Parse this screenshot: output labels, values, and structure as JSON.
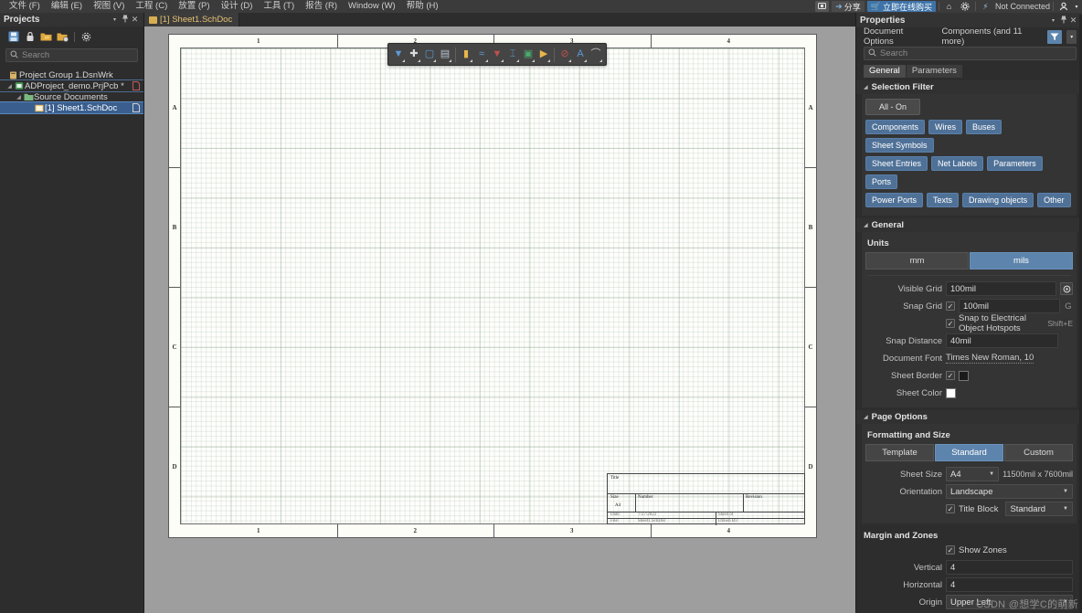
{
  "menubar": {
    "items": [
      {
        "label": "文件 (F)"
      },
      {
        "label": "编辑 (E)"
      },
      {
        "label": "视图 (V)"
      },
      {
        "label": "工程 (C)"
      },
      {
        "label": "放置 (P)"
      },
      {
        "label": "设计 (D)"
      },
      {
        "label": "工具 (T)"
      },
      {
        "label": "报告 (R)"
      },
      {
        "label": "Window (W)"
      },
      {
        "label": "帮助 (H)"
      }
    ],
    "right": {
      "notification_icon": "message-icon",
      "share_label": "分享",
      "share_icon": "share-arrow-icon",
      "buy_label": "立即在线购买",
      "buy_icon": "cart-icon",
      "home_icon": "home-icon",
      "settings_icon": "gear-icon",
      "connection_icon": "plug-icon",
      "connection_status": "Not Connected",
      "account_icon": "user-icon",
      "account_caret": "▾"
    }
  },
  "projects_panel": {
    "title": "Projects",
    "header_buttons": [
      "▾",
      "📌",
      "✕"
    ],
    "toolbar_icons": [
      "save-icon",
      "lock-icon",
      "open-project-icon",
      "add-folder-icon",
      "gear-icon"
    ],
    "search": {
      "placeholder": "Search",
      "value": "",
      "icon": "search-icon"
    },
    "tree": [
      {
        "label": "Project Group 1.DsnWrk",
        "icon": "workspace-icon",
        "level": 1,
        "arrow": "",
        "selected": false,
        "outlined": false,
        "right_icon": ""
      },
      {
        "label": "ADProject_demo.PrjPcb *",
        "icon": "project-icon",
        "level": 2,
        "arrow": "◢",
        "selected": false,
        "outlined": true,
        "right_icon": "doc-red-icon"
      },
      {
        "label": "Source Documents",
        "icon": "folder-icon",
        "level": 3,
        "arrow": "◢",
        "selected": false,
        "outlined": false,
        "right_icon": ""
      },
      {
        "label": "[1] Sheet1.SchDoc",
        "icon": "sheet-icon",
        "level": 4,
        "arrow": "",
        "selected": true,
        "outlined": false,
        "right_icon": "doc-icon"
      }
    ]
  },
  "document_tabs": [
    {
      "label": "[1] Sheet1.SchDoc",
      "icon": "schdoc-icon",
      "active": true
    }
  ],
  "float_toolbar": {
    "buttons": [
      {
        "name": "filter-icon",
        "glyph": "▼",
        "color": "#5d9bd5",
        "dropdown": true
      },
      {
        "name": "crosshair-place-icon",
        "glyph": "✚",
        "color": "#dcdcdc",
        "dropdown": true
      },
      {
        "name": "select-area-icon",
        "glyph": "▢",
        "color": "#5d9bd5",
        "dropdown": true
      },
      {
        "name": "align-icon",
        "glyph": "▤",
        "color": "#b8c4cf",
        "dropdown": true
      },
      {
        "name": "place-part-icon",
        "glyph": "▮",
        "color": "#e8b64a",
        "dropdown": true
      },
      {
        "name": "place-wire-icon",
        "glyph": "≈",
        "color": "#5d9bd5",
        "dropdown": true
      },
      {
        "name": "place-power-port-icon",
        "glyph": "▼",
        "color": "#c0504d",
        "dropdown": true
      },
      {
        "name": "place-net-label-icon",
        "glyph": "⌶",
        "color": "#5d9bd5",
        "dropdown": true
      },
      {
        "name": "place-sheet-symbol-icon",
        "glyph": "▣",
        "color": "#4aa96c",
        "dropdown": true
      },
      {
        "name": "place-port-icon",
        "glyph": "▶",
        "color": "#e8b64a",
        "dropdown": true
      },
      {
        "name": "no-erc-icon",
        "glyph": "⊘",
        "color": "#c0504d",
        "dropdown": true
      },
      {
        "name": "place-text-icon",
        "glyph": "A",
        "color": "#5d9bd5",
        "dropdown": true
      },
      {
        "name": "place-arc-icon",
        "glyph": "⌒",
        "color": "#c9c9c9",
        "dropdown": true
      }
    ]
  },
  "schematic": {
    "zones_top": [
      "1",
      "2",
      "3",
      "4"
    ],
    "zones_bottom": [
      "1",
      "2",
      "3",
      "4"
    ],
    "zones_left": [
      "A",
      "B",
      "C",
      "D"
    ],
    "zones_right": [
      "A",
      "B",
      "C",
      "D"
    ],
    "title_block": {
      "title_label": "Title",
      "title_value": "",
      "size_label": "Size",
      "size_value": "A4",
      "number_label": "Number",
      "number_value": "",
      "revision_label": "Revision",
      "revision_value": "",
      "date_label": "Date:",
      "date_value": "7/27/2022",
      "sheet_label": "Sheet   of",
      "file_label": "File:",
      "file_value": "Sheet1.SchDoc",
      "drawnby_label": "Drawn By:",
      "side_marker": "D"
    }
  },
  "properties_panel": {
    "title": "Properties",
    "header_buttons": [
      "▾",
      "📌",
      "✕"
    ],
    "object_type": "Document Options",
    "selection_summary": "Components (and 11 more)",
    "filter_icon": "funnel-icon",
    "filter_caret": "▾",
    "search": {
      "placeholder": "Search",
      "value": "",
      "icon": "search-icon"
    },
    "tabs": [
      {
        "label": "General",
        "active": true
      },
      {
        "label": "Parameters",
        "active": false
      }
    ],
    "selection_filter": {
      "section_title": "Selection Filter",
      "all_on_label": "All - On",
      "chips": [
        "Components",
        "Wires",
        "Buses",
        "Sheet Symbols",
        "Sheet Entries",
        "Net Labels",
        "Parameters",
        "Ports",
        "Power Ports",
        "Texts",
        "Drawing objects",
        "Other"
      ]
    },
    "general": {
      "section_title": "General",
      "units_label": "Units",
      "units_options": [
        {
          "label": "mm",
          "selected": false
        },
        {
          "label": "mils",
          "selected": true
        }
      ],
      "visible_grid_label": "Visible Grid",
      "visible_grid_value": "100mil",
      "visible_grid_btn_icon": "grid-settings-icon",
      "snap_grid_label": "Snap Grid",
      "snap_grid_checked": true,
      "snap_grid_value": "100mil",
      "snap_grid_shortcut": "G",
      "snap_hotspots_checked": true,
      "snap_hotspots_label": "Snap to Electrical Object Hotspots",
      "snap_hotspots_shortcut": "Shift+E",
      "snap_distance_label": "Snap Distance",
      "snap_distance_value": "40mil",
      "document_font_label": "Document Font",
      "document_font_value": "Times New Roman, 10",
      "sheet_border_label": "Sheet Border",
      "sheet_border_checked": true,
      "sheet_border_color": "#1a1a1a",
      "sheet_color_label": "Sheet Color",
      "sheet_color": "#ffffff"
    },
    "page_options": {
      "section_title": "Page Options",
      "formatting_title": "Formatting and Size",
      "format_options": [
        {
          "label": "Template",
          "selected": false
        },
        {
          "label": "Standard",
          "selected": true
        },
        {
          "label": "Custom",
          "selected": false
        }
      ],
      "sheet_size_label": "Sheet Size",
      "sheet_size_value": "A4",
      "sheet_dimensions": "11500mil x 7600mil",
      "orientation_label": "Orientation",
      "orientation_value": "Landscape",
      "title_block_label": "Title Block",
      "title_block_checked": true,
      "title_block_value": "Standard"
    },
    "margin_and_zones": {
      "section_title": "Margin and Zones",
      "show_zones_label": "Show Zones",
      "show_zones_checked": true,
      "vertical_label": "Vertical",
      "vertical_value": "4",
      "horizontal_label": "Horizontal",
      "horizontal_value": "4",
      "origin_label": "Origin",
      "origin_value": "Upper Left"
    }
  },
  "watermark": "CSDN @想学C的萌新",
  "colors": {
    "accent": "#5d84ac",
    "chip": "#4f7197",
    "panel_bg": "#2d2d2d",
    "canvas_bg": "#9e9e9e",
    "sheet_bg": "#fdfdf7"
  }
}
